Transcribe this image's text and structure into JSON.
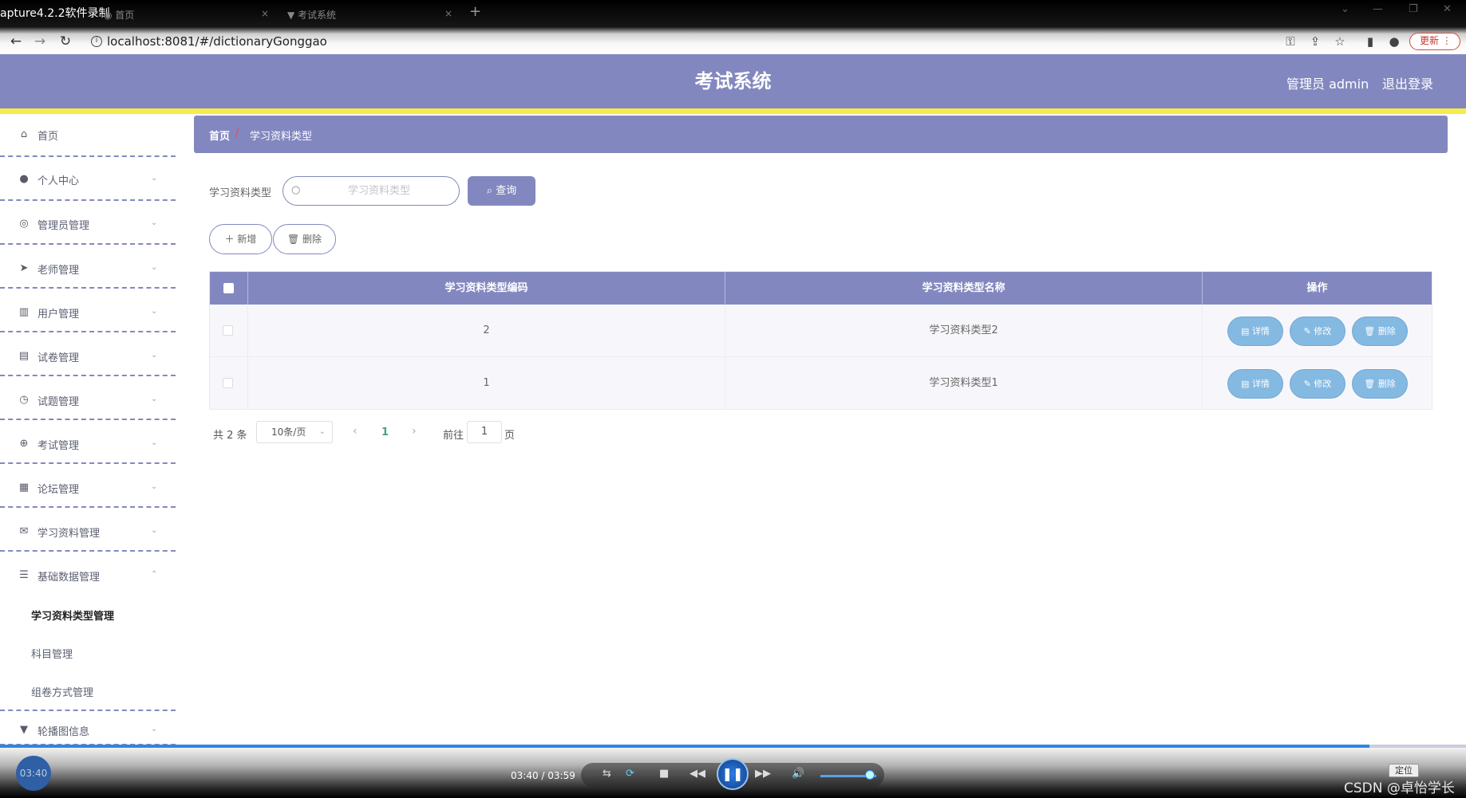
{
  "browser": {
    "recorder_label": "apture4.2.2软件录制",
    "tabs": [
      {
        "label": "首页",
        "close": "×"
      },
      {
        "label": "考试系统",
        "close": "×"
      }
    ],
    "new_tab": "+",
    "url": "localhost:8081/#/dictionaryGonggao",
    "update_label": "更新"
  },
  "header": {
    "title": "考试系统",
    "user": "管理员 admin",
    "logout": "退出登录"
  },
  "sidebar": {
    "items": [
      {
        "label": "首页",
        "icon": "home-icon"
      },
      {
        "label": "个人中心",
        "icon": "user-icon"
      },
      {
        "label": "管理员管理",
        "icon": "compass-icon"
      },
      {
        "label": "老师管理",
        "icon": "send-icon"
      },
      {
        "label": "用户管理",
        "icon": "bar-chart-icon"
      },
      {
        "label": "试卷管理",
        "icon": "clipboard-icon"
      },
      {
        "label": "试题管理",
        "icon": "clock-icon"
      },
      {
        "label": "考试管理",
        "icon": "target-icon"
      },
      {
        "label": "论坛管理",
        "icon": "grid-icon"
      },
      {
        "label": "学习资料管理",
        "icon": "mail-icon"
      },
      {
        "label": "基础数据管理",
        "icon": "sliders-icon"
      }
    ],
    "subitems": [
      {
        "label": "学习资料类型管理",
        "active": true
      },
      {
        "label": "科目管理",
        "active": false
      },
      {
        "label": "组卷方式管理",
        "active": false
      }
    ],
    "last_item": {
      "label": "轮播图信息",
      "icon": "pin-icon"
    }
  },
  "breadcrumb": {
    "home": "首页",
    "separator": "/",
    "current": "学习资料类型"
  },
  "search": {
    "label": "学习资料类型",
    "placeholder": "学习资料类型",
    "query_button": "查询"
  },
  "actions": {
    "add": "新增",
    "delete": "删除"
  },
  "table": {
    "columns": [
      "学习资料类型编码",
      "学习资料类型名称",
      "操作"
    ],
    "rows": [
      {
        "code": "2",
        "name": "学习资料类型2"
      },
      {
        "code": "1",
        "name": "学习资料类型1"
      }
    ],
    "op_labels": {
      "detail": "详情",
      "edit": "修改",
      "delete": "删除"
    }
  },
  "pagination": {
    "total": "共 2 条",
    "page_size": "10条/页",
    "current_page": "1",
    "goto_label": "前往",
    "goto_value": "1",
    "page_suffix": "页"
  },
  "player": {
    "clock": "03:40",
    "time": "03:40 / 03:59",
    "progress": 0.934,
    "locate_label": "定位",
    "watermark": "CSDN @卓怡学长"
  },
  "colors": {
    "primary": "#8288bf",
    "accent_stripe": "#f5ec4d",
    "op_button": "#84b9e2",
    "active_page": "#44a37a"
  }
}
